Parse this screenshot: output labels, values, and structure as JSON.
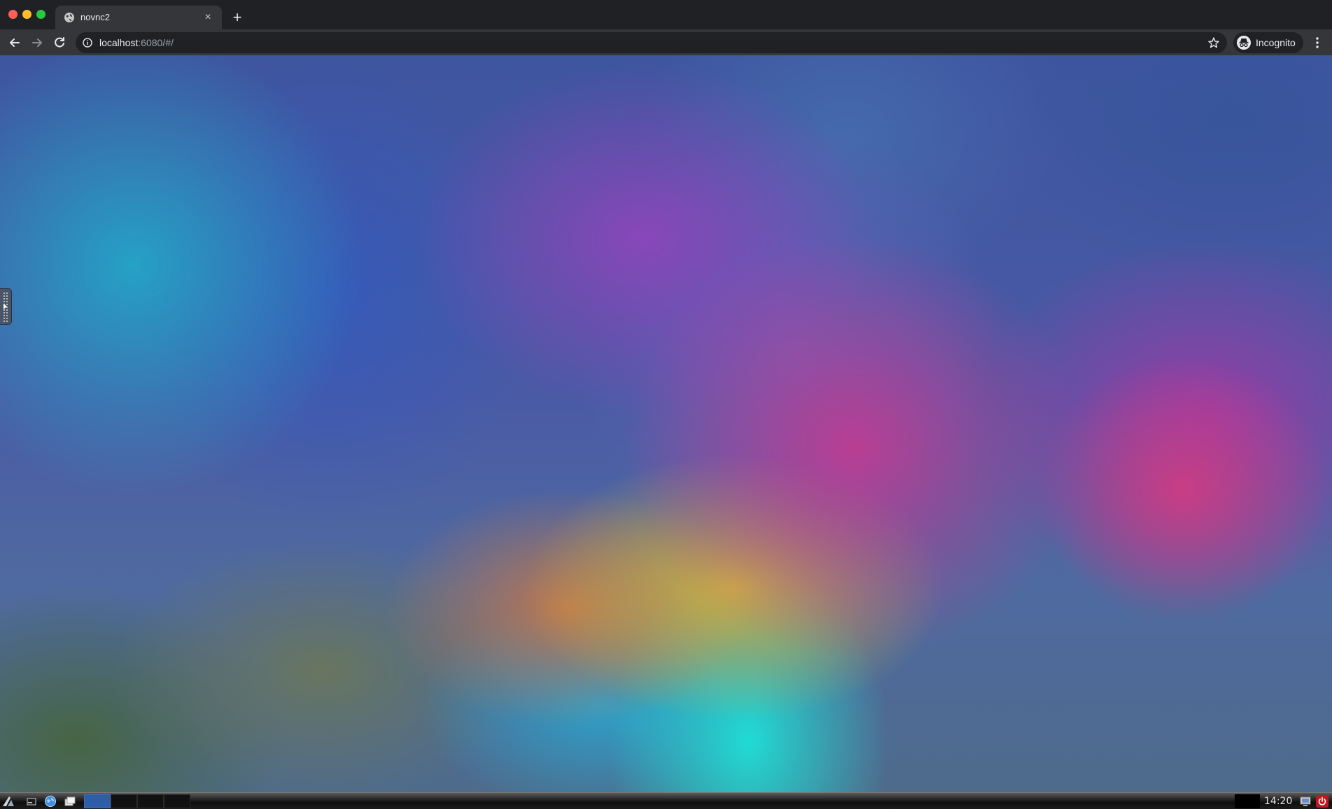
{
  "browser": {
    "tab": {
      "title": "novnc2",
      "close_glyph": "×"
    },
    "new_tab_glyph": "+",
    "address": {
      "host": "localhost",
      "rest": ":6080/#/"
    },
    "profile_label": "Incognito"
  },
  "icons": {
    "back": "arrow-left-icon",
    "forward": "arrow-right-icon",
    "reload": "reload-icon",
    "info": "info-icon",
    "bookmark": "star-icon",
    "incognito": "incognito-icon",
    "menu": "kebab-menu-icon"
  },
  "taskbar": {
    "clock": "14:20",
    "workspaces": [
      {
        "active": true
      },
      {
        "active": false
      },
      {
        "active": false
      },
      {
        "active": false
      }
    ]
  },
  "colors": {
    "tab_active": "#35363a",
    "chrome_frame": "#202124",
    "workspace_active": "#2f5ea8",
    "power": "#c0171f"
  }
}
